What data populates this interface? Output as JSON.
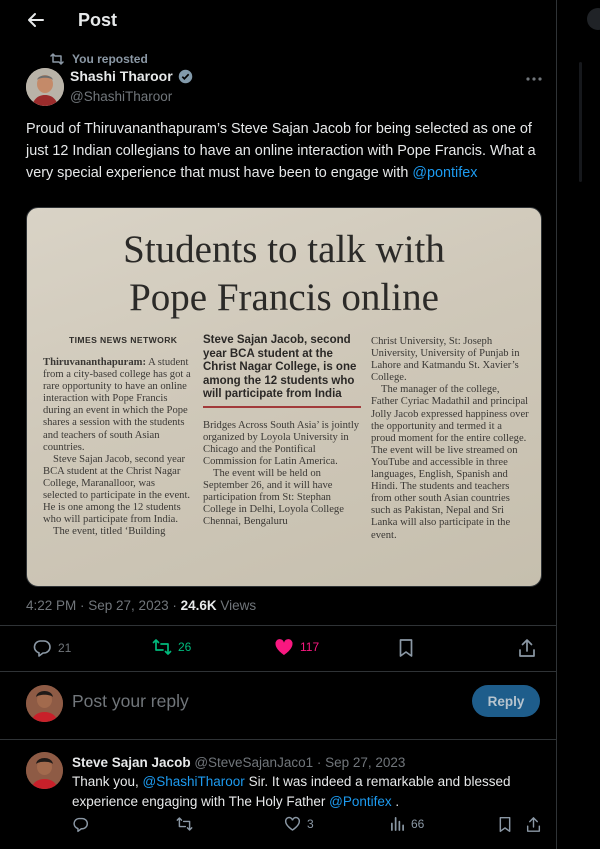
{
  "header": {
    "title": "Post"
  },
  "repost_label": "You reposted",
  "author": {
    "name": "Shashi Tharoor",
    "handle": "@ShashiTharoor"
  },
  "tweet": {
    "text_before": "Proud of Thiruvananthapuram’s Steve Sajan Jacob for being selected as one of just 12 Indian collegians to have an online interaction with Pope Francis. What a very special experience that must have been to engage with ",
    "mention": "@pontifex"
  },
  "news": {
    "headline_line1": "Students to talk with",
    "headline_line2": "Pope Francis online",
    "byline": "TIMES NEWS NETWORK",
    "col1_lead": "Thiruvananthapuram:",
    "col1_p1": " A student from a city-based college has got a rare opportunity to have an online interaction with Pope Francis during an event in which the Pope shares a session with the students and teachers of south Asian countries.",
    "col1_p2": "Steve Sajan Jacob, second year BCA student at the Christ Nagar College, Maranalloor, was selected to participate in the event. He is one among the 12 students who will participate from India.",
    "col1_p3": "The event, titled ‘Building",
    "pullquote": "Steve Sajan Jacob, second year BCA student at the Christ Nagar College, is one among the 12 students who will participate from India",
    "col2_p1": "Bridges Across South Asia’ is jointly organized by Loyola University in Chicago and the Pontifical Commission for Latin America.",
    "col2_p2": "The event will be held on September 26, and it will have participation from St: Stephan College in Delhi, Loyola College Chennai, Bengaluru",
    "col3_p1": "Christ University, St: Joseph University, University of Punjab in Lahore and Katmandu St. Xavier’s College.",
    "col3_p2": "The manager of the college, Father Cyriac Madathil and principal Jolly Jacob expressed happiness over the opportunity and termed it a proud moment for the entire college. The event will be live streamed on YouTube and accessible in three languages, English, Spanish and Hindi. The students and teachers from other south Asian countries such as Pakistan, Nepal and Sri Lanka will also participate in the event."
  },
  "meta": {
    "time": "4:22 PM · Sep 27, 2023 · ",
    "views_count": "24.6K",
    "views_label": " Views"
  },
  "actions": {
    "replies": "21",
    "reposts": "26",
    "likes": "117"
  },
  "reply_box": {
    "placeholder": "Post your reply",
    "button": "Reply"
  },
  "reply": {
    "name": "Steve Sajan Jacob",
    "handle_date": " @SteveSajanJaco1 · Sep 27, 2023",
    "text_before": "Thank you, ",
    "mention1": "@ShashiTharoor",
    "text_middle": " Sir. It was indeed a remarkable and blessed experience engaging with The Holy Father ",
    "mention2": "@Pontifex",
    "text_after": " .",
    "likes": "3",
    "views": "66"
  },
  "colors": {
    "like": "#f91880",
    "repost": "#00ba7c",
    "link": "#1d9bf0",
    "verified": "#829aab"
  }
}
